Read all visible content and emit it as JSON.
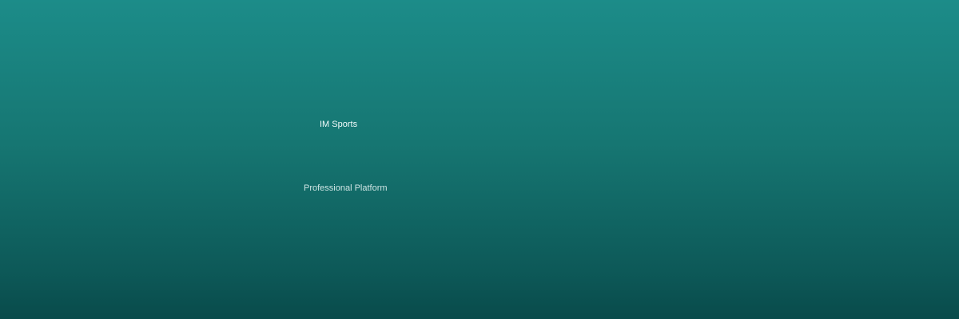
{
  "banner": {
    "title": "IM Sports",
    "tagline": "Professional Platform",
    "colors": {
      "gradient_top": "#1c8c89",
      "gradient_bottom": "#094b4b",
      "title_text": "#f2fbfb",
      "tagline_text": "#cfe5e4"
    }
  }
}
